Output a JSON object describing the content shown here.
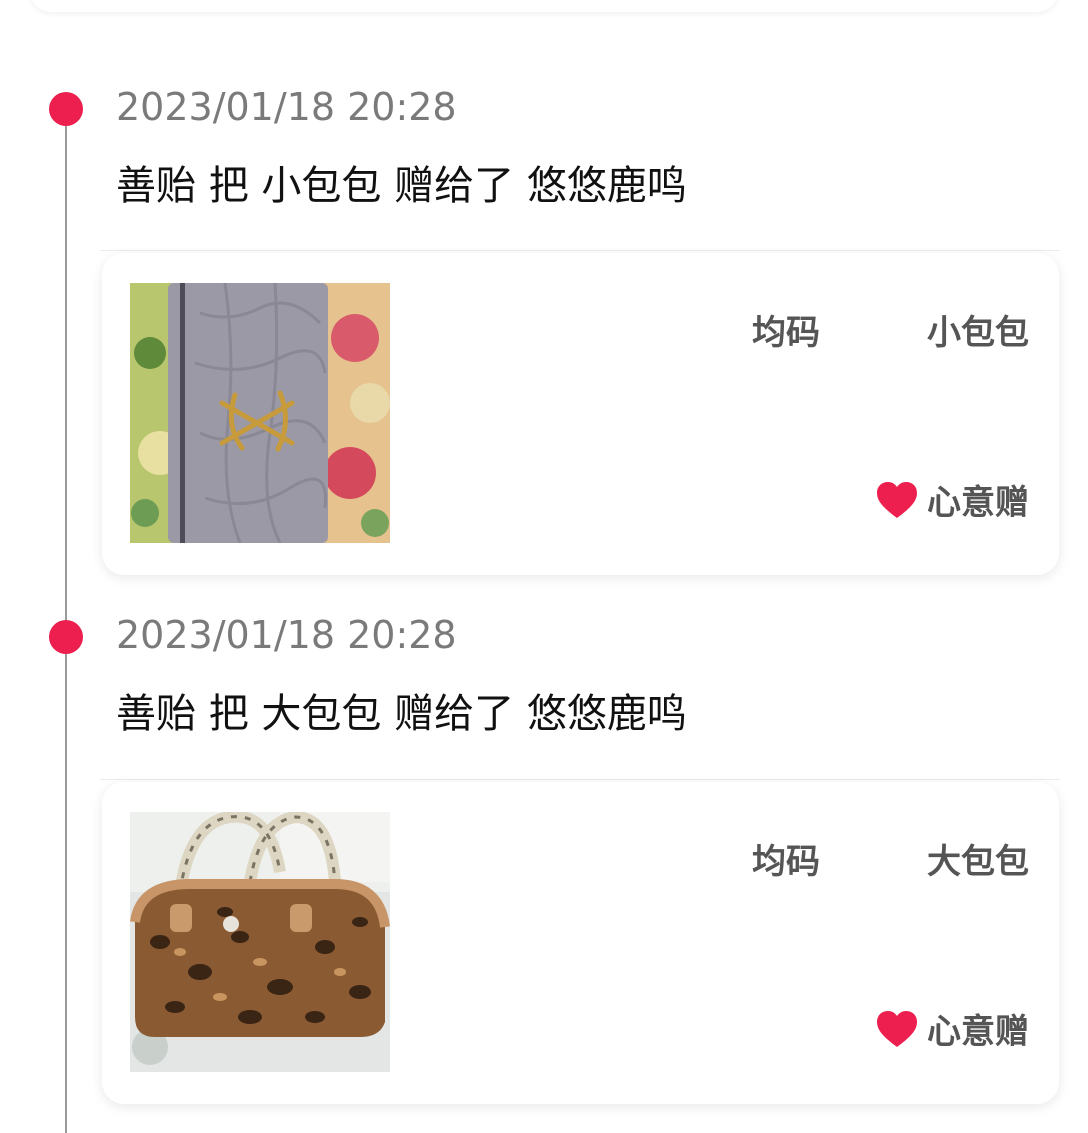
{
  "accent_color": "#ec1f4f",
  "entries": [
    {
      "timestamp": "2023/01/18 20:28",
      "message": "善贻 把 小包包 赠给了 悠悠鹿鸣",
      "item": {
        "size": "均码",
        "name": "小包包",
        "gift_type": "心意赠",
        "gift_icon": "heart-icon",
        "image": "grey-croc-wallet-photo"
      }
    },
    {
      "timestamp": "2023/01/18 20:28",
      "message": "善贻 把 大包包 赠给了 悠悠鹿鸣",
      "item": {
        "size": "均码",
        "name": "大包包",
        "gift_type": "心意赠",
        "gift_icon": "heart-icon",
        "image": "leopard-handbag-photo"
      }
    }
  ]
}
